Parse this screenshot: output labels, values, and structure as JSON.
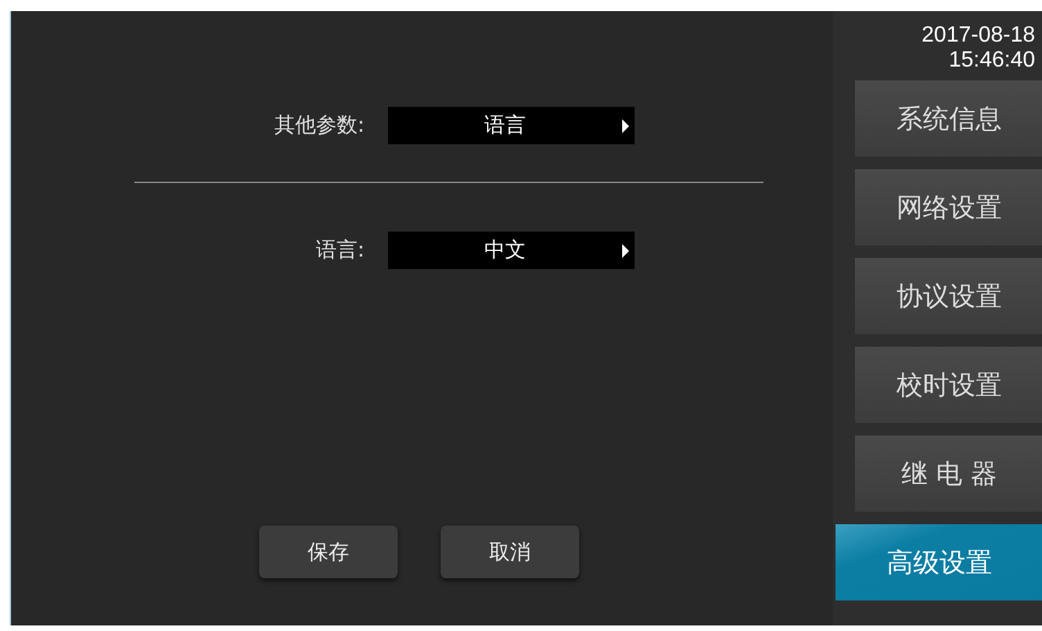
{
  "form": {
    "rows": [
      {
        "label": "其他参数:",
        "value": "语言"
      },
      {
        "label": "语言:",
        "value": "中文"
      }
    ],
    "buttons": [
      "保存",
      "取消"
    ]
  },
  "clock": {
    "date": "2017-08-18",
    "time": "15:46:40"
  },
  "sidebar": {
    "items": [
      {
        "label": "系统信息",
        "selected": false
      },
      {
        "label": "网络设置",
        "selected": false
      },
      {
        "label": "协议设置",
        "selected": false
      },
      {
        "label": "校时设置",
        "selected": false
      },
      {
        "label": "继 电 器",
        "selected": false
      },
      {
        "label": "高级设置",
        "selected": true
      }
    ]
  }
}
